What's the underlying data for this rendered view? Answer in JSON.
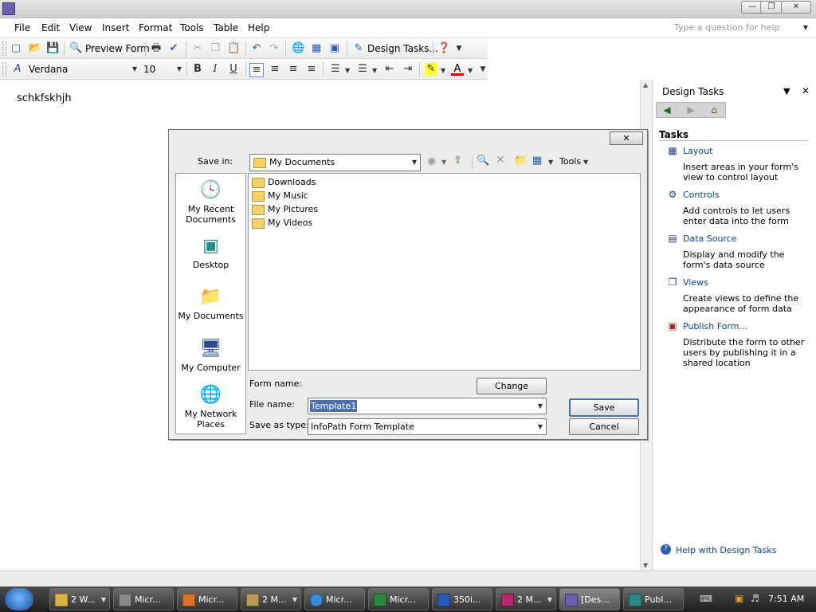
{
  "menubar": {
    "items": [
      "File",
      "Edit",
      "View",
      "Insert",
      "Format",
      "Tools",
      "Table",
      "Help"
    ],
    "help_placeholder": "Type a question for help"
  },
  "toolbar_standard": {
    "preview_form": "Preview Form",
    "design_tasks": "Design Tasks..."
  },
  "toolbar_format": {
    "font": "Verdana",
    "size": "10",
    "bold": "B",
    "italic": "I",
    "underline": "U"
  },
  "canvas": {
    "text": "schkfskhjh"
  },
  "task_pane": {
    "title": "Design Tasks",
    "section": "Tasks",
    "items": [
      {
        "label": "Layout",
        "desc": "Insert areas in your form's view to control layout",
        "icon": "layout-icon"
      },
      {
        "label": "Controls",
        "desc": "Add controls to let users enter data into the form",
        "icon": "controls-icon"
      },
      {
        "label": "Data Source",
        "desc": "Display and modify the form's data source",
        "icon": "data-source-icon"
      },
      {
        "label": "Views",
        "desc": "Create views to define the appearance of form data",
        "icon": "views-icon"
      },
      {
        "label": "Publish Form...",
        "desc": "Distribute the form to other users by publishing it in a shared location",
        "icon": "publish-icon"
      }
    ],
    "help_link": "Help with Design Tasks"
  },
  "save_dialog": {
    "save_in_label": "Save in:",
    "save_in_value": "My Documents",
    "tools_label": "Tools",
    "places": [
      {
        "label": "My Recent Documents",
        "icon": "recent-documents-icon"
      },
      {
        "label": "Desktop",
        "icon": "desktop-icon"
      },
      {
        "label": "My Documents",
        "icon": "my-documents-icon"
      },
      {
        "label": "My Computer",
        "icon": "my-computer-icon"
      },
      {
        "label": "My Network Places",
        "icon": "network-places-icon"
      }
    ],
    "files": [
      "Downloads",
      "My Music",
      "My Pictures",
      "My Videos"
    ],
    "form_name_label": "Form name:",
    "change_name_button": "Change Name...",
    "file_name_label": "File name:",
    "file_name_value": "Template1",
    "save_as_type_label": "Save as type:",
    "save_as_type_value": "InfoPath Form Template",
    "save_button": "Save",
    "cancel_button": "Cancel"
  },
  "taskbar": {
    "tasks": [
      "2 W...",
      "Micr...",
      "Micr...",
      "2 M...",
      "Micr...",
      "Micr...",
      "350i...",
      "2 M...",
      "[Des...",
      "Publ..."
    ],
    "clock": "7:51 AM"
  }
}
